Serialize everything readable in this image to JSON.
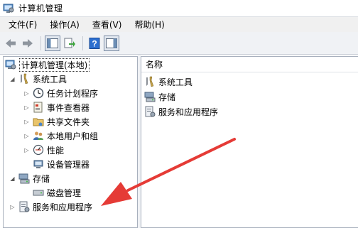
{
  "window": {
    "title": "计算机管理"
  },
  "menu": [
    {
      "label": "文件(F)"
    },
    {
      "label": "操作(A)"
    },
    {
      "label": "查看(V)"
    },
    {
      "label": "帮助(H)"
    }
  ],
  "toolbar": {
    "buttons": [
      "back-arrow-icon",
      "forward-arrow-icon",
      "show-hide-tree-icon",
      "export-list-icon",
      "help-icon",
      "action-pane-icon"
    ]
  },
  "tree": {
    "root": "计算机管理(本地)",
    "system_tools": "系统工具",
    "task_scheduler": "任务计划程序",
    "event_viewer": "事件查看器",
    "shared_folders": "共享文件夹",
    "local_users": "本地用户和组",
    "performance": "性能",
    "device_manager": "设备管理器",
    "storage": "存储",
    "disk_management": "磁盘管理",
    "services_apps": "服务和应用程序"
  },
  "list": {
    "column_name": "名称",
    "items": [
      "系统工具",
      "存储",
      "服务和应用程序"
    ]
  },
  "colors": {
    "annotation_arrow": "#e53b36",
    "pane_border": "#a8b0bd"
  }
}
